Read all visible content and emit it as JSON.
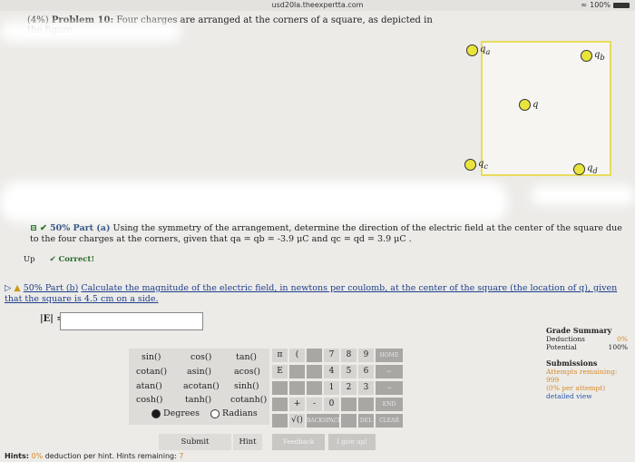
{
  "statusbar": {
    "url": "usd20la.theexpertta.com",
    "battery": "100%"
  },
  "problem": {
    "prefix": "(4%)",
    "title": "Problem 10:",
    "statement": "Four charges are arranged at the corners of a square, as depicted in the figure."
  },
  "figure": {
    "charges": [
      {
        "label": "q",
        "sub": "a"
      },
      {
        "label": "q",
        "sub": "b"
      },
      {
        "label": "q",
        "sub": ""
      },
      {
        "label": "q",
        "sub": "c"
      },
      {
        "label": "q",
        "sub": "d"
      }
    ]
  },
  "part_a": {
    "lead": "50% Part (a)",
    "text": "Using the symmetry of the arrangement, determine the direction of the electric field at the center of the square due to the four charges at the corners, given that",
    "given": "qa = qb = -3.9 μC and qc = qd = 3.9 μC .",
    "status_up": "Up",
    "status_correct": "Correct!"
  },
  "part_b": {
    "lead": "50% Part (b)",
    "text": "Calculate the magnitude of the electric field, in newtons per coulomb, at the center of the square (the location of q), given that the square is 4.5 cm on a side.",
    "label": "|E| ="
  },
  "calculator": {
    "functions": [
      "sin()",
      "cos()",
      "tan()",
      "cotan()",
      "asin()",
      "acos()",
      "atan()",
      "acotan()",
      "sinh()",
      "cosh()",
      "tanh()",
      "cotanh()"
    ],
    "degrees": "Degrees",
    "radians": "Radians",
    "keys": [
      "π",
      "(",
      "",
      "7",
      "8",
      "9",
      "HOME",
      "E",
      "",
      "",
      "4",
      "5",
      "6",
      "←",
      "",
      "",
      "",
      "1",
      "2",
      "3",
      "→",
      "",
      "+",
      "-",
      "0",
      "",
      "",
      "END",
      "",
      "√()",
      "BACKSPACE",
      "",
      "DEL",
      "CLEAR"
    ]
  },
  "buttons": {
    "submit": "Submit",
    "hint": "Hint",
    "feedback": "Feedback",
    "give_up": "I give up!"
  },
  "grade_summary": {
    "title": "Grade Summary",
    "deductions_label": "Deductions",
    "deductions_value": "0%",
    "potential_label": "Potential",
    "potential_value": "100%",
    "submissions_title": "Submissions",
    "attempts": "Attempts remaining: 999",
    "per_attempt": "(0% per attempt)",
    "detailed": "detailed view"
  },
  "hints": {
    "label": "Hints:",
    "pct": "0%",
    "text": "deduction per hint. Hints remaining:",
    "remaining": "7"
  }
}
